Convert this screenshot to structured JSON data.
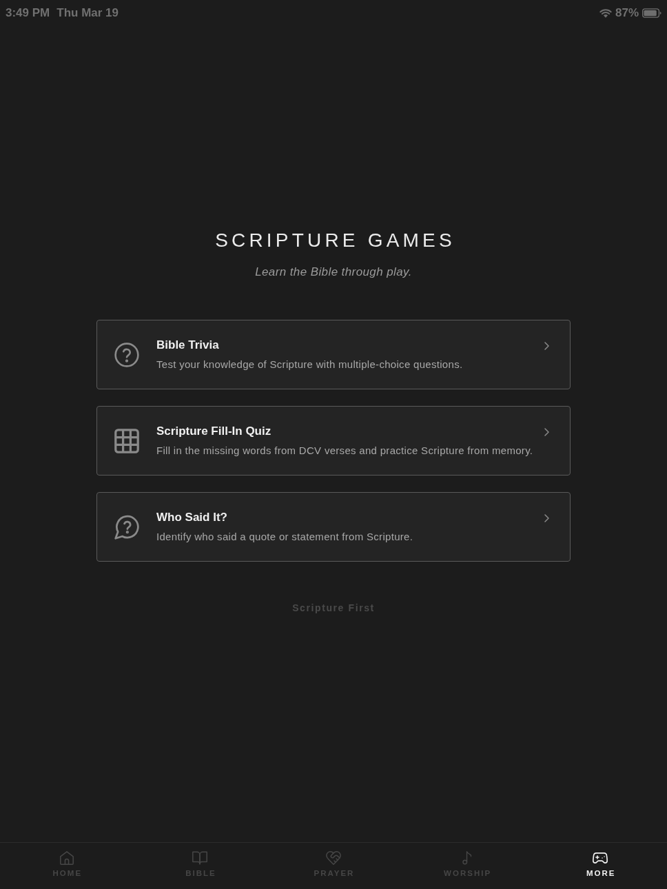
{
  "status_bar": {
    "time": "3:49 PM",
    "date": "Thu Mar 19",
    "battery": "87%"
  },
  "header": {
    "title": "SCRIPTURE GAMES",
    "subtitle": "Learn the Bible through play."
  },
  "games": [
    {
      "title": "Bible Trivia",
      "description": "Test your knowledge of Scripture with multiple-choice questions."
    },
    {
      "title": "Scripture Fill-In Quiz",
      "description": "Fill in the missing words from DCV verses and practice Scripture from memory."
    },
    {
      "title": "Who Said It?",
      "description": "Identify who said a quote or statement from Scripture."
    }
  ],
  "footer": "Scripture First",
  "tab_bar": [
    {
      "label": "HOME",
      "selected": false
    },
    {
      "label": "BIBLE",
      "selected": false
    },
    {
      "label": "PRAYER",
      "selected": false
    },
    {
      "label": "WORSHIP",
      "selected": false
    },
    {
      "label": "MORE",
      "selected": true
    }
  ]
}
